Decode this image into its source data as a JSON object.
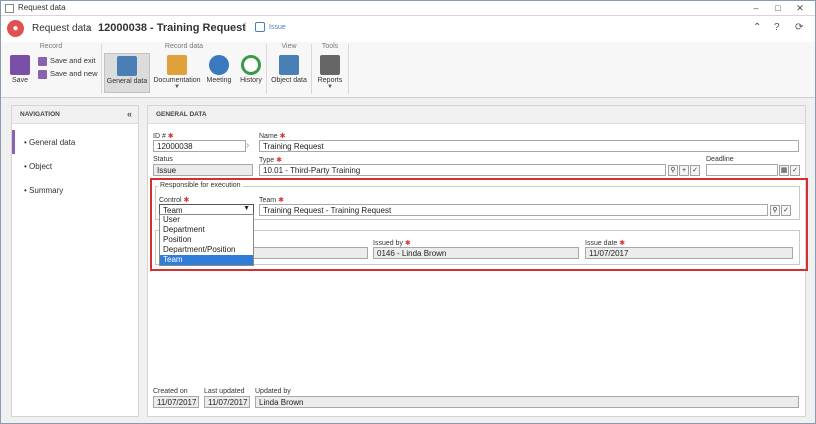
{
  "window": {
    "title": "Request data"
  },
  "header": {
    "breadcrumb_root": "Request data",
    "record_title": "12000038 - Training Request",
    "status_link": "Issue"
  },
  "ribbon": {
    "groups": {
      "record": "Record",
      "record_data": "Record data",
      "view": "View",
      "tools": "Tools"
    },
    "save": "Save",
    "save_and_exit": "Save and exit",
    "save_and_new": "Save and new",
    "general_data": "General data",
    "documentation": "Documentation",
    "meeting": "Meeting",
    "history": "History",
    "object_data": "Object data",
    "reports": "Reports"
  },
  "nav": {
    "heading": "NAVIGATION",
    "items": [
      "General data",
      "Object",
      "Summary"
    ]
  },
  "main": {
    "heading": "GENERAL DATA",
    "id_label": "ID #",
    "id_value": "12000038",
    "name_label": "Name",
    "name_value": "Training Request",
    "status_label": "Status",
    "status_value": "Issue",
    "type_label": "Type",
    "type_value": "10.01 - Third-Party Training",
    "deadline_label": "Deadline",
    "deadline_value": "",
    "responsible_legend": "Responsible for execution",
    "control_label": "Control",
    "control_value": "Team",
    "control_options": [
      "User",
      "Department",
      "Position",
      "Department/Position",
      "Team"
    ],
    "team_label": "Team",
    "team_value": "Training Request - Training Request",
    "issued_by_label": "Issued by",
    "issued_by_value": "0146 - Linda Brown",
    "issue_date_label": "Issue date",
    "issue_date_value": "11/07/2017",
    "created_on_label": "Created on",
    "created_on_value": "11/07/2017",
    "last_updated_label": "Last updated",
    "last_updated_value": "11/07/2017",
    "updated_by_label": "Updated by",
    "updated_by_value": "Linda Brown"
  },
  "colors": {
    "accent": "#8a62b0",
    "highlight": "#d43030",
    "selection": "#2f7dd9"
  }
}
